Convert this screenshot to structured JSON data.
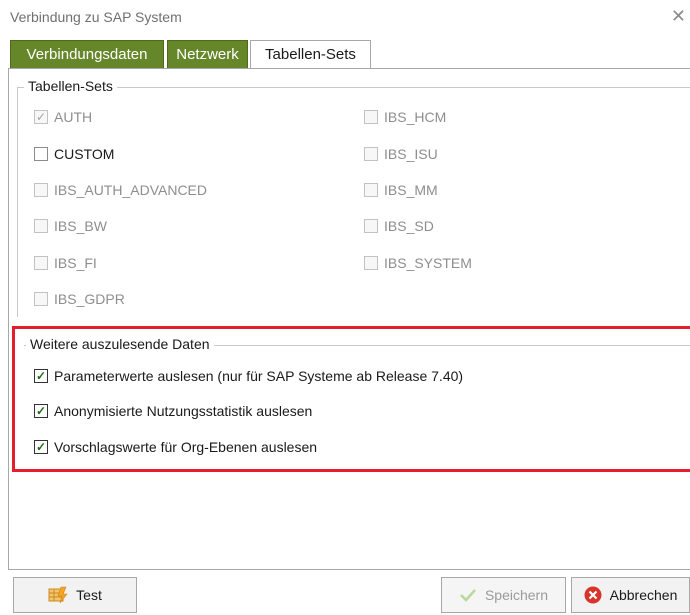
{
  "window": {
    "title": "Verbindung zu SAP System",
    "close_glyph": "✕"
  },
  "tabs": [
    {
      "label": "Verbindungsdaten",
      "active": false
    },
    {
      "label": "Netzwerk",
      "active": false
    },
    {
      "label": "Tabellen-Sets",
      "active": true
    }
  ],
  "tabellen_sets": {
    "title": "Tabellen-Sets",
    "left": [
      {
        "label": "AUTH",
        "checked": true,
        "disabled": true
      },
      {
        "label": "CUSTOM",
        "checked": false,
        "disabled": false
      },
      {
        "label": "IBS_AUTH_ADVANCED",
        "checked": false,
        "disabled": true
      },
      {
        "label": "IBS_BW",
        "checked": false,
        "disabled": true
      },
      {
        "label": "IBS_FI",
        "checked": false,
        "disabled": true
      },
      {
        "label": "IBS_GDPR",
        "checked": false,
        "disabled": true
      }
    ],
    "right": [
      {
        "label": "IBS_HCM",
        "checked": false,
        "disabled": true
      },
      {
        "label": "IBS_ISU",
        "checked": false,
        "disabled": true
      },
      {
        "label": "IBS_MM",
        "checked": false,
        "disabled": true
      },
      {
        "label": "IBS_SD",
        "checked": false,
        "disabled": true
      },
      {
        "label": "IBS_SYSTEM",
        "checked": false,
        "disabled": true
      }
    ]
  },
  "weitere": {
    "title": "Weitere auszulesende Daten",
    "items": [
      {
        "label": "Parameterwerte auslesen (nur für SAP Systeme ab Release 7.40)",
        "checked": true
      },
      {
        "label": "Anonymisierte Nutzungsstatistik auslesen",
        "checked": true
      },
      {
        "label": "Vorschlagswerte für Org-Ebenen auslesen",
        "checked": true
      }
    ]
  },
  "buttons": {
    "test": "Test",
    "save": "Speichern",
    "cancel": "Abbrechen"
  },
  "colors": {
    "tab_green": "#66862a",
    "highlight_red": "#e31e2d",
    "check_green": "#1f6b16"
  }
}
